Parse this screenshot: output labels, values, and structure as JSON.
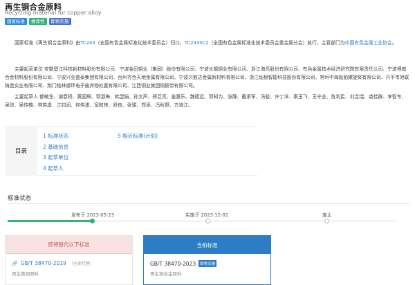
{
  "header": {
    "title": "再生铜合金原料",
    "subtitle": "Recycling material for copper alloy",
    "tags": [
      "国家标准",
      "推荐性",
      "即将实施"
    ]
  },
  "description": {
    "p1_a": "国家标准《再生铜合金原料》由",
    "p1_link1": "TC243",
    "p1_b": "（全国有色金属标准化技术委员会）归口，",
    "p1_link2": "TC243SC2",
    "p1_c": "（全国有色金属标准化技术委员会重金属分会）执行，主管部门为",
    "p1_link3": "中国有色金属工业协会",
    "p1_d": "。",
    "p2": "主要起草单位 安徽楚江科技新材料股份有限公司、宁波金田铜业（集团）股份有限公司、宁波长振铜业有限公司、浙江海亮股份有限公司、有色金属技术经济研究院有限责任公司、宁波博威合金材料股份有限公司、宁波兴业盛泰集团有限公司、台州齐合天地金属有限公司、宁波兴敖达金属新材料有限公司、浙江灿根智能科技股份有限公司、常州中海船舶螺旋桨有限公司、开平市旭联铸造实业有限公司、荆门格林循环电子废弃物处置有限公司、江西铜业集团铜板带有限公司。",
    "p3": "主要起草人 都敏生、谢春桥、黄国辉、郭淑梅、韩翌娟、孙文声、郑巨亮、姜惠乐、魏德远、郭知为、张静、戴承军、冯骏、许丁洋、秦玉飞、王守业、危利民、刘念瑞、裘桂群、李智专、吴琼、吴传楠、林若虚、江钧润、何伟浦、宽和锋、舒良、张骏、郑添、冯秋野、方道江。"
  },
  "toc": {
    "heading": "目录",
    "items": [
      "1 标准状态",
      "2 基础信息",
      "3 起草单位",
      "4 起草人",
      "5 相近标准(计划)"
    ]
  },
  "status": {
    "heading": "标准状态",
    "timeline": [
      {
        "label": "发布于 2023-05-23",
        "done": true
      },
      {
        "label": "实施于 2023-12-01",
        "done": false
      },
      {
        "label": "废止",
        "done": false
      }
    ]
  },
  "cards": {
    "replaced": {
      "heading": "即将替代以下标准",
      "code": "GB/T 38470-2019",
      "note": "（全部代替）",
      "name": "再生黄铜原料"
    },
    "current": {
      "heading": "当前标准",
      "code": "GB/T 38470-2023",
      "badge": "即将实施",
      "name": "再生铜合金原料"
    }
  },
  "colors": {
    "link": "#2d7cc6",
    "done": "#35b17a",
    "replaced_bg": "#f9e2e2",
    "current_bg": "#2d7cc6"
  }
}
